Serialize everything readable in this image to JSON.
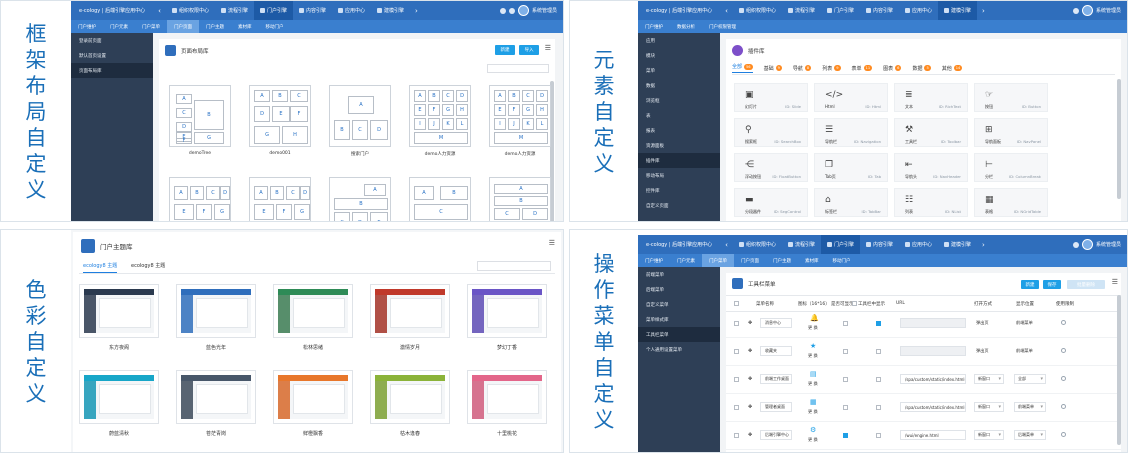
{
  "labels": {
    "q1": [
      "框",
      "架",
      "布",
      "局",
      "自",
      "定",
      "义"
    ],
    "q2": [
      "元",
      "素",
      "自",
      "定",
      "义"
    ],
    "q3": [
      "色",
      "彩",
      "自",
      "定",
      "义"
    ],
    "q4": [
      "操",
      "作",
      "菜",
      "单",
      "自",
      "定",
      "义"
    ]
  },
  "app": {
    "title": "e-cology | 后端引擎应用中心",
    "nav_tabs": [
      "组织权限中心",
      "流程引擎",
      "门户引擎",
      "内容引擎",
      "应用中心",
      "建模引擎"
    ],
    "user": "系统管理员",
    "user_avatar_text": "系统"
  },
  "q1": {
    "subtabs": [
      "门户维护",
      "门户元素",
      "门户菜单",
      "门户页面",
      "门户主题",
      "素材库",
      "移动门户"
    ],
    "sidebar": [
      "登录前页面",
      "默认首页设置",
      "页面布局库"
    ],
    "panel_title": "页面布局库",
    "btn_new": "新建",
    "btn_import": "导入",
    "templates": [
      {
        "name": "demoTree",
        "cells": [
          "A",
          "C",
          "B",
          "D",
          "E",
          "F",
          "G"
        ]
      },
      {
        "name": "demo001",
        "cells": [
          "A",
          "B",
          "C",
          "D",
          "E",
          "F",
          "G",
          "H"
        ]
      },
      {
        "name": "搜索门户",
        "cells": [
          "A",
          "B",
          "C",
          "D"
        ]
      },
      {
        "name": "demo人力资源",
        "cells": [
          "A",
          "B",
          "C",
          "D",
          "E",
          "F",
          "G",
          "H",
          "I",
          "J",
          "K",
          "L",
          "M"
        ]
      },
      {
        "name": "demo人力资源",
        "cells": [
          "A",
          "B",
          "C",
          "D",
          "E",
          "F",
          "G",
          "H",
          "I",
          "J",
          "K",
          "L",
          "M"
        ]
      },
      {
        "name": "",
        "cells": [
          "A",
          "B",
          "C",
          "D",
          "E",
          "F",
          "G"
        ]
      },
      {
        "name": "",
        "cells": [
          "A",
          "B",
          "C",
          "D",
          "E",
          "F",
          "G"
        ]
      },
      {
        "name": "",
        "cells": [
          "A",
          "B",
          "C",
          "D",
          "E",
          "F",
          "G"
        ]
      },
      {
        "name": "",
        "cells": [
          "A",
          "B",
          "C",
          "D"
        ]
      },
      {
        "name": "",
        "cells": [
          "A",
          "B",
          "C",
          "D",
          "E"
        ]
      }
    ]
  },
  "q2": {
    "subtabs": [
      "门户维护",
      "数据分析",
      "门户权限管理"
    ],
    "sidebar": [
      "应用",
      "模块",
      "菜单",
      "数据",
      "浏览框",
      "表",
      "报表",
      "资源面板",
      "插件库",
      "移动布局",
      "控件库",
      "自定义页面"
    ],
    "active_sidebar": "插件库",
    "panel_title": "插件库",
    "tabs": [
      {
        "label": "全部",
        "count": "56"
      },
      {
        "label": "基础",
        "count": "9"
      },
      {
        "label": "导航",
        "count": "8"
      },
      {
        "label": "列表",
        "count": "9"
      },
      {
        "label": "表单",
        "count": "11"
      },
      {
        "label": "图表",
        "count": "6"
      },
      {
        "label": "数据",
        "count": "5"
      },
      {
        "label": "其他",
        "count": "14"
      }
    ],
    "elements": [
      {
        "name": "幻灯片",
        "id": "ID: Slide",
        "icon": "slide-icon",
        "glyph": "▣"
      },
      {
        "name": "Html",
        "id": "ID: Html",
        "icon": "code-icon",
        "glyph": "</>"
      },
      {
        "name": "文本",
        "id": "ID: RichText",
        "icon": "text-icon",
        "glyph": "≣"
      },
      {
        "name": "按钮",
        "id": "ID: Button",
        "icon": "button-icon",
        "glyph": "☞"
      },
      {
        "name": "搜索框",
        "id": "ID: SearchBox",
        "icon": "search-icon",
        "glyph": "⚲"
      },
      {
        "name": "导航栏",
        "id": "ID: Navigation",
        "icon": "list-icon",
        "glyph": "☰"
      },
      {
        "name": "工具栏",
        "id": "ID: Toolbar",
        "icon": "wrench-icon",
        "glyph": "⚒"
      },
      {
        "name": "导航面板",
        "id": "ID: NavPanel",
        "icon": "grid-icon",
        "glyph": "⊞"
      },
      {
        "name": "浮动按钮",
        "id": "ID: FloatButton",
        "icon": "share-icon",
        "glyph": "⋲"
      },
      {
        "name": "Tab页",
        "id": "ID: Tab",
        "icon": "tab-icon",
        "glyph": "❐"
      },
      {
        "name": "导航头",
        "id": "ID: NavHeader",
        "icon": "outdent-icon",
        "glyph": "⇤"
      },
      {
        "name": "分栏",
        "id": "ID: ColumnBreak",
        "icon": "column-icon",
        "glyph": "⊢"
      },
      {
        "name": "分段器件",
        "id": "ID: SegControl",
        "icon": "segment-icon",
        "glyph": "▬"
      },
      {
        "name": "标签栏",
        "id": "ID: TabBar",
        "icon": "tag-icon",
        "glyph": "⌂"
      },
      {
        "name": "列表",
        "id": "ID: NList",
        "icon": "nlist-icon",
        "glyph": "☷"
      },
      {
        "name": "表格",
        "id": "ID: NGridTable",
        "icon": "table-icon",
        "glyph": "▦"
      }
    ]
  },
  "q3": {
    "panel_title": "门户主题库",
    "tabs": [
      "ecology8 主题",
      "ecology8 主题"
    ],
    "themes": [
      {
        "name": "东方夜阁",
        "header": "#2b3a4f",
        "side": "#2b3a4f"
      },
      {
        "name": "蓝色光年",
        "header": "#2f6ebc",
        "side": "#2f6ebc"
      },
      {
        "name": "松林思绪",
        "header": "#2e8b57",
        "side": "#3b7b52"
      },
      {
        "name": "激情岁月",
        "header": "#c0392b",
        "side": "#a33227"
      },
      {
        "name": "梦幻丁香",
        "header": "#6a55c6",
        "side": "#5d4bb5"
      },
      {
        "name": "蔚蓝清秋",
        "header": "#17a6c8",
        "side": "#1596b5"
      },
      {
        "name": "苍茫青岗",
        "header": "#48576a",
        "side": "#3c4a5b"
      },
      {
        "name": "鲜橙飘香",
        "header": "#e8772b",
        "side": "#d7692a"
      },
      {
        "name": "枯木逢春",
        "header": "#8bb339",
        "side": "#7ba032"
      },
      {
        "name": "十里桃花",
        "header": "#e3668a",
        "side": "#d05c7d"
      }
    ]
  },
  "q4": {
    "subtabs": [
      "门户维护",
      "门户元素",
      "门户菜单",
      "门户页面",
      "门户主题",
      "素材库",
      "移动门户"
    ],
    "sidebar": [
      "前端菜单",
      "后端菜单",
      "自定义菜单",
      "菜单样式库",
      "工具栏菜单",
      "个人通用设置菜单"
    ],
    "active_sidebar": "工具栏菜单",
    "panel_title": "工具栏菜单",
    "btn_new": "新建",
    "btn_save": "保存",
    "btn_delete": "批量删除",
    "columns": [
      "菜单名称",
      "图标（16*16）",
      "是否可显示",
      "工具栏中显示",
      "URL",
      "打开方式",
      "显示位置",
      "使用限制"
    ],
    "change_label": "更 换",
    "rows": [
      {
        "name": "消息中心",
        "url": "",
        "open": "弹出页",
        "pos": "前端菜单",
        "show": false,
        "toolbar": true,
        "open_is_select": false,
        "pos_is_select": false
      },
      {
        "name": "收藏夹",
        "url": "",
        "open": "弹出页",
        "pos": "前端菜单",
        "show": false,
        "toolbar": false,
        "open_is_select": false,
        "pos_is_select": false
      },
      {
        "name": "前端工作桌面",
        "url": "/spa/custom/static/index.html#/...",
        "open": "新窗口",
        "pos": "全部",
        "show": false,
        "toolbar": false,
        "open_is_select": true,
        "pos_is_select": true
      },
      {
        "name": "管理者桌面",
        "url": "/spa/custom/static/index.html#/...",
        "open": "新窗口",
        "pos": "前端菜单",
        "show": false,
        "toolbar": false,
        "open_is_select": true,
        "pos_is_select": true
      },
      {
        "name": "后端引擎中心",
        "url": "/wui/engine.html",
        "open": "新窗口",
        "pos": "后端菜单",
        "show": true,
        "toolbar": false,
        "open_is_select": true,
        "pos_is_select": true
      }
    ]
  }
}
